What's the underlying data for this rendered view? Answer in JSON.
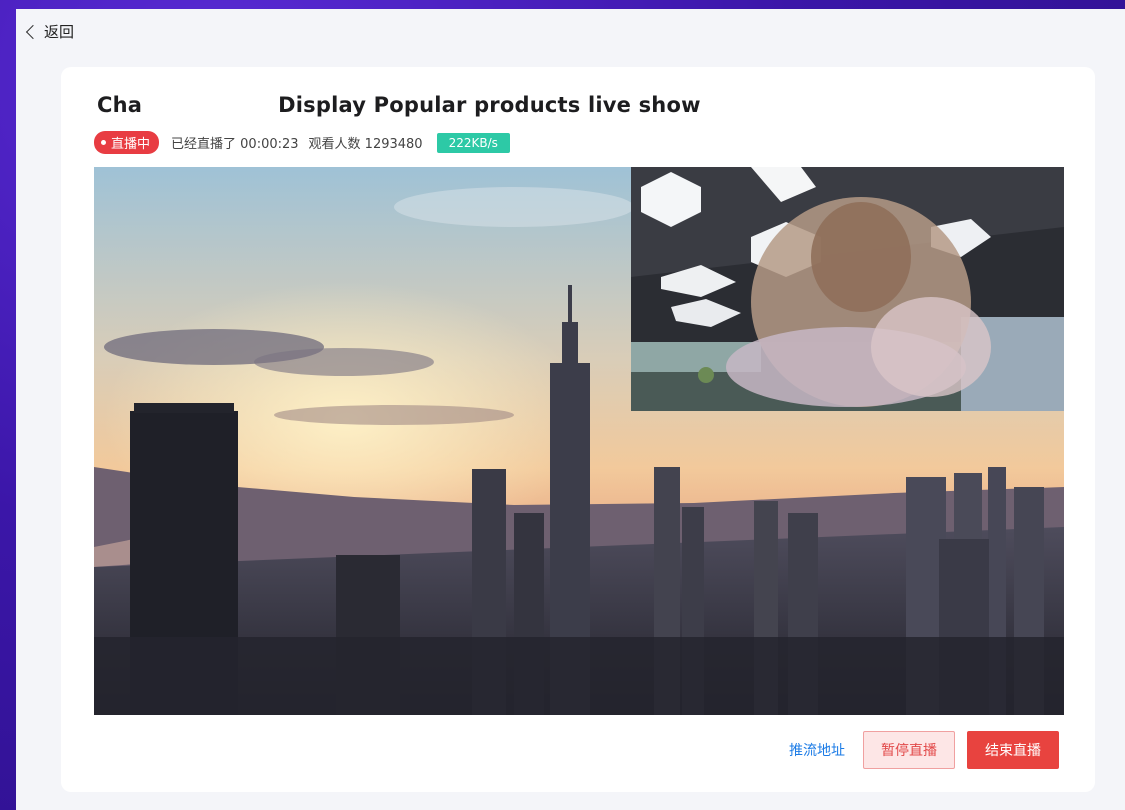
{
  "nav": {
    "back_label": "返回"
  },
  "stream": {
    "title_start": "Cha",
    "title_rest": "Display Popular products live show",
    "live_label": "直播中",
    "elapsed_text": "已经直播了 00:00:23",
    "viewers_text": "观看人数 1293480",
    "bitrate": "222KB/s"
  },
  "actions": {
    "push_url_label": "推流地址",
    "pause_label": "暂停直播",
    "end_label": "结束直播"
  },
  "colors": {
    "live_red": "#e83c42",
    "bitrate_green": "#2dc9a6",
    "link_blue": "#1b7be6",
    "background_purple": "#3b16a8"
  }
}
